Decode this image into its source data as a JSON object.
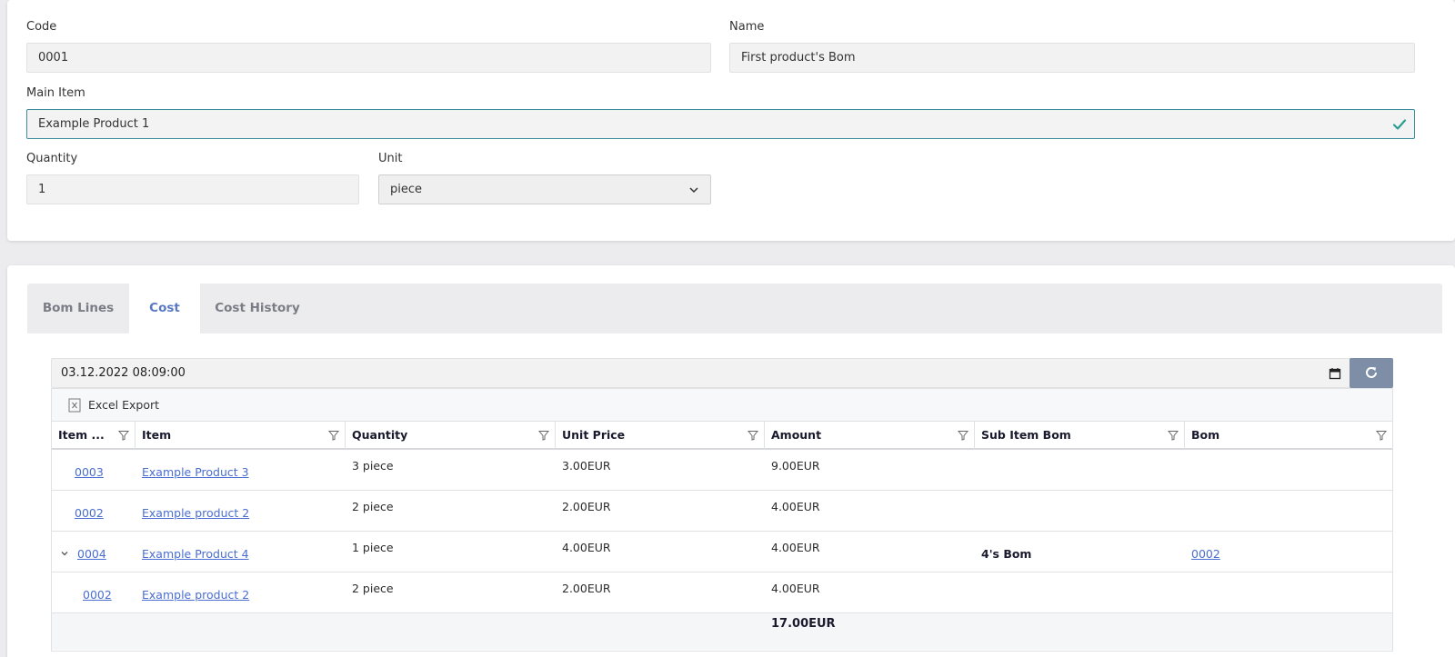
{
  "form": {
    "code_label": "Code",
    "code_value": "0001",
    "name_label": "Name",
    "name_value": "First product's Bom",
    "main_item_label": "Main Item",
    "main_item_value": "Example Product 1",
    "quantity_label": "Quantity",
    "quantity_value": "1",
    "unit_label": "Unit",
    "unit_value": "piece"
  },
  "tabs": [
    {
      "label": "Bom Lines"
    },
    {
      "label": "Cost"
    },
    {
      "label": "Cost History"
    }
  ],
  "active_tab": "Cost",
  "datetime_value": "03.12.2022 08:09:00",
  "toolbar": {
    "excel_export_label": "Excel Export"
  },
  "grid": {
    "columns": [
      {
        "label": "Item ..."
      },
      {
        "label": "Item"
      },
      {
        "label": "Quantity"
      },
      {
        "label": "Unit Price"
      },
      {
        "label": "Amount"
      },
      {
        "label": "Sub Item Bom"
      },
      {
        "label": "Bom"
      }
    ],
    "rows": [
      {
        "code": "0003",
        "item": "Example Product 3",
        "quantity": "3 piece",
        "unit_price": "3.00EUR",
        "amount": "9.00EUR",
        "sub_item_bom": "",
        "bom": ""
      },
      {
        "code": "0002",
        "item": "Example product 2",
        "quantity": "2 piece",
        "unit_price": "2.00EUR",
        "amount": "4.00EUR",
        "sub_item_bom": "",
        "bom": ""
      },
      {
        "code": "0004",
        "item": "Example Product 4",
        "quantity": "1 piece",
        "unit_price": "4.00EUR",
        "amount": "4.00EUR",
        "sub_item_bom": "4's Bom",
        "bom": "0002"
      },
      {
        "code": "0002",
        "item": "Example product 2",
        "quantity": "2 piece",
        "unit_price": "2.00EUR",
        "amount": "4.00EUR",
        "sub_item_bom": "",
        "bom": ""
      }
    ],
    "total_amount": "17.00EUR"
  },
  "colors": {
    "accent": "#5a79c4",
    "focus_border": "#3a8f9c",
    "check": "#2a9d8f",
    "refresh_button": "#7f8ea7",
    "link": "#4a6ed1"
  }
}
